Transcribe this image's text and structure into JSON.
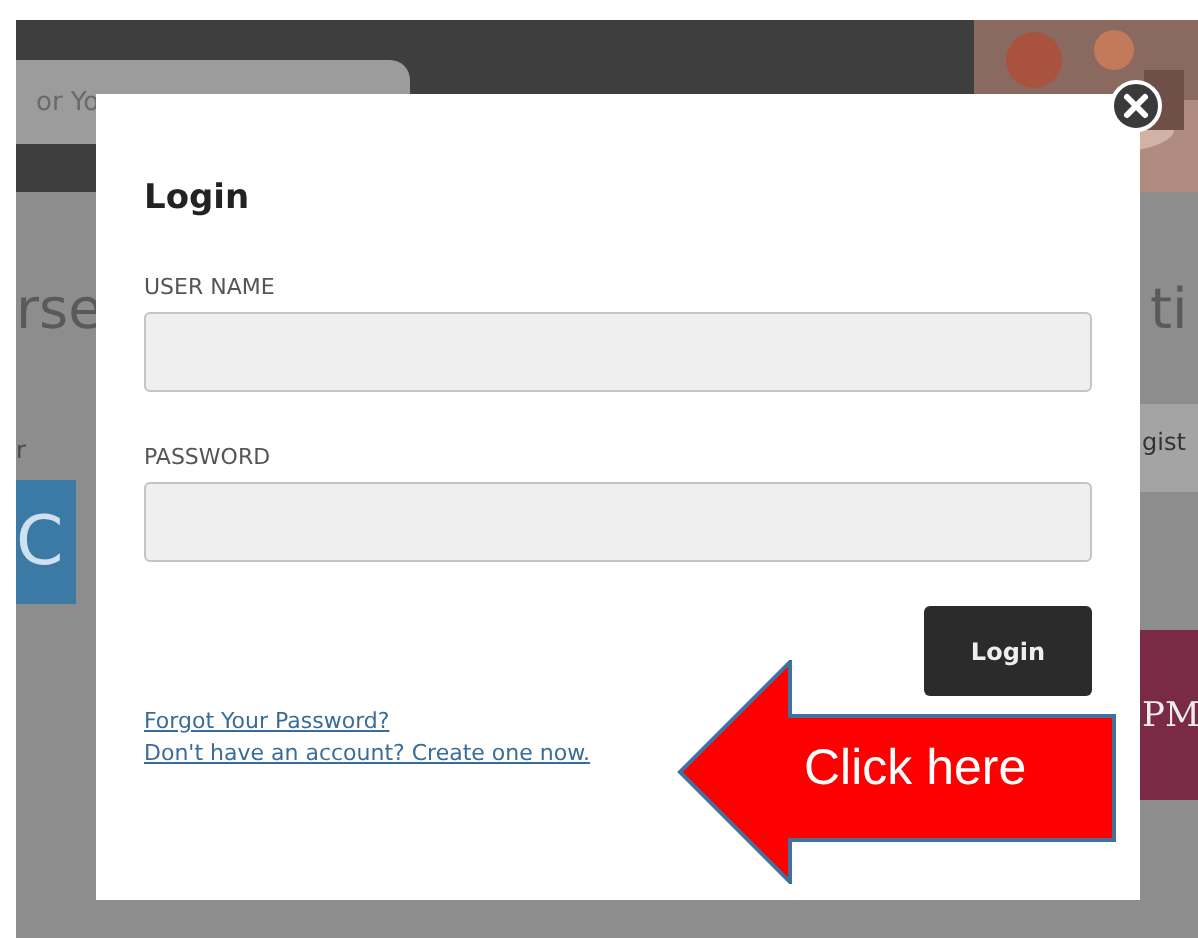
{
  "background": {
    "search_text": "or Yo",
    "fragments": [
      {
        "kind": "heading-left",
        "text": "rse"
      },
      {
        "kind": "heading-right",
        "text": "ti"
      },
      {
        "kind": "label-left",
        "text": "r"
      },
      {
        "kind": "tab-right",
        "text": "gist"
      },
      {
        "kind": "tile-left",
        "text": "C"
      },
      {
        "kind": "tile-right",
        "text": "PM"
      }
    ]
  },
  "dialog": {
    "title": "Login",
    "fields": [
      {
        "label": "USER NAME"
      },
      {
        "label": "PASSWORD"
      }
    ],
    "button": "Login",
    "links": [
      "Forgot Your Password?",
      "Don't have an account? Create one now."
    ]
  },
  "callout": {
    "text": "Click here"
  }
}
